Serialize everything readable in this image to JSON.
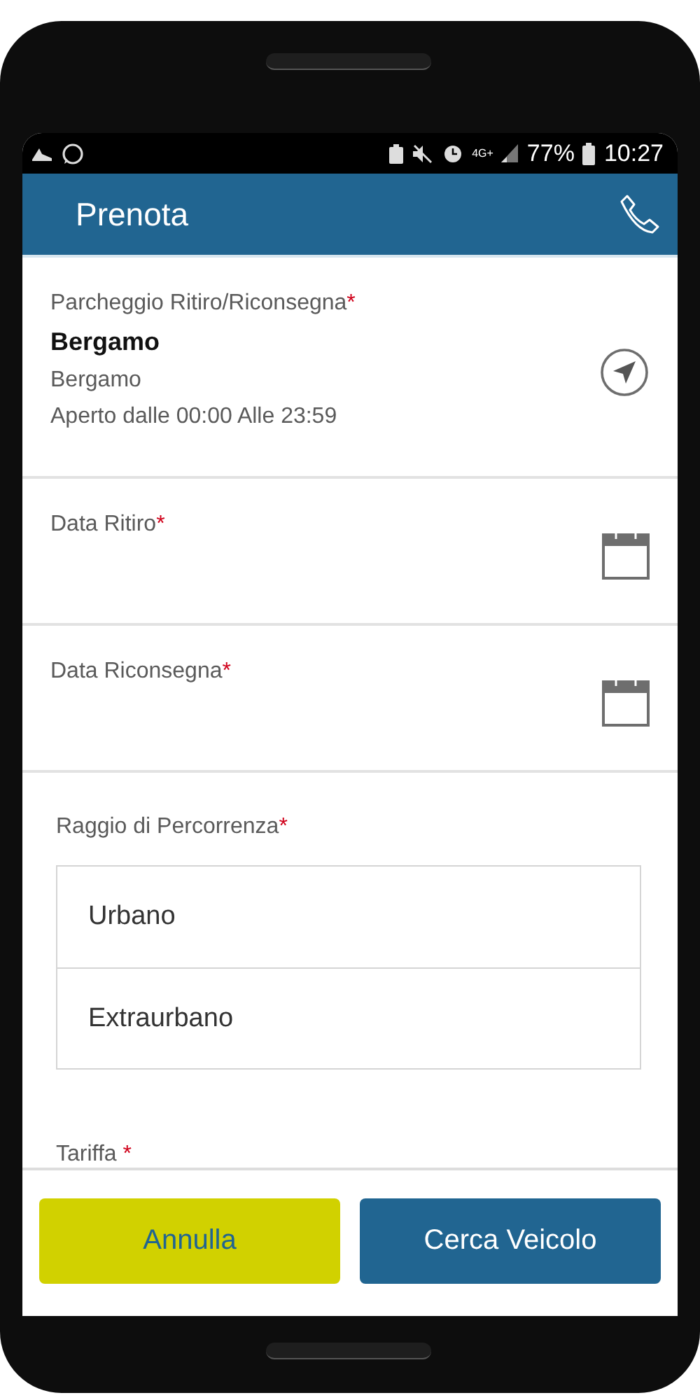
{
  "status_bar": {
    "network": "4G+",
    "battery": "77%",
    "time": "10:27"
  },
  "header": {
    "title": "Prenota"
  },
  "parking": {
    "label": "Parcheggio Ritiro/Riconsegna",
    "required": "*",
    "name": "Bergamo",
    "city": "Bergamo",
    "hours": "Aperto dalle 00:00 Alle 23:59"
  },
  "dates": [
    {
      "label": "Data Ritiro",
      "required": "*"
    },
    {
      "label": "Data Riconsegna",
      "required": "*"
    }
  ],
  "range": {
    "label": "Raggio di Percorrenza",
    "required": "*",
    "options": [
      {
        "label": "Urbano",
        "selected": false
      },
      {
        "label": "Extraurbano",
        "selected": false
      }
    ]
  },
  "tariff": {
    "label": "Tariffa",
    "required": "*"
  },
  "buttons": [
    {
      "label": "Annulla",
      "kind": "secondary"
    },
    {
      "label": "Cerca Veicolo",
      "kind": "primary"
    }
  ]
}
